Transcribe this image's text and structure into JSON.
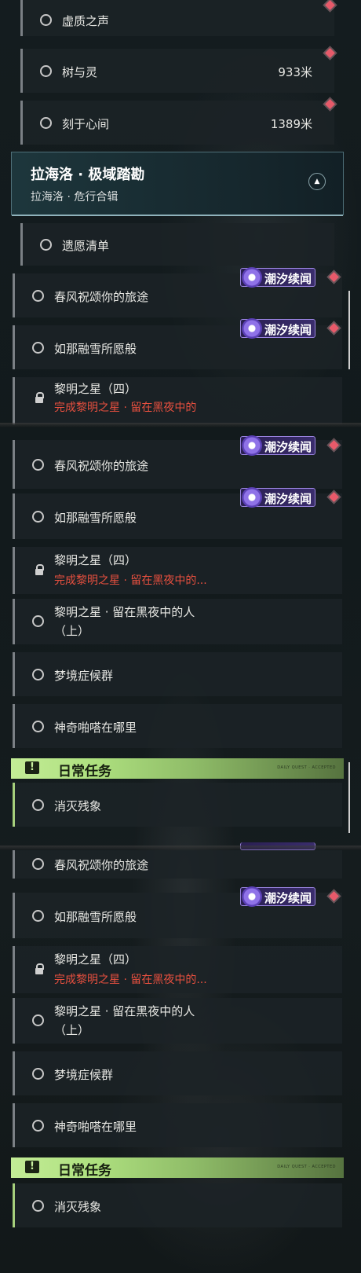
{
  "accent_colors": {
    "tag": "#9a84e0",
    "daily": "#c3ec96",
    "warning_text": "#e8503f",
    "diamond": "#e85a6a"
  },
  "top_quests": [
    {
      "label": "虚质之声"
    },
    {
      "label": "树与灵",
      "distance": "933米"
    },
    {
      "label": "刻于心间",
      "distance": "1389米"
    }
  ],
  "region": {
    "title": "拉海洛 · 极域踏勘",
    "subtitle": "拉海洛 · 危行合辑",
    "toggle_icon": "chevron-up-icon"
  },
  "quest_names": {
    "q1": "遗愿清单",
    "q2": "春风祝颂你的旅途",
    "q3": "如那融雪所愿般",
    "q4": "黎明之星（四）",
    "q4_req": "完成黎明之星 · 留在黑夜中的...",
    "q5_line1": "黎明之星 · 留在黑夜中的人",
    "q5_line2": "（上）",
    "q6": "梦境症候群",
    "q7": "神奇啪嗒在哪里",
    "q8": "消灭残象",
    "q4_req_cut": "完成黎明之星 · 留在黑夜中的"
  },
  "tag_label": "潮汐续闻",
  "tag_icon": "tide-spiral-icon",
  "daily": {
    "title": "日常任务",
    "icon_glyph": "!",
    "footer": "DAILY QUEST · ACCEPTED"
  }
}
